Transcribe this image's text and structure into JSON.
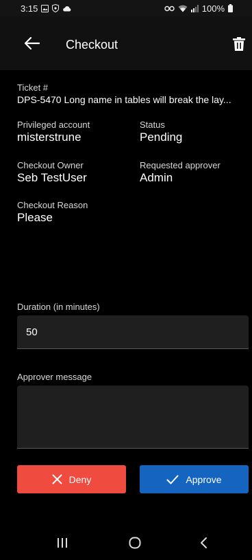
{
  "status_bar": {
    "time": "3:15",
    "battery": "100%",
    "left_icons": [
      "image-icon",
      "shield-icon",
      "cloud-icon"
    ],
    "right_icons": [
      "link-icon",
      "wifi-icon",
      "signal-icon",
      "battery-icon"
    ]
  },
  "app_bar": {
    "title": "Checkout",
    "back_icon": "arrow-left-icon",
    "delete_icon": "trash-icon"
  },
  "details": {
    "ticket_label": "Ticket #",
    "ticket_value": "DPS-5470 Long name in tables will break the lay...",
    "privileged_label": "Privileged account",
    "privileged_value": "misterstrune",
    "status_label": "Status",
    "status_value": "Pending",
    "owner_label": "Checkout Owner",
    "owner_value": "Seb TestUser",
    "approver_label": "Requested approver",
    "approver_value": "Admin",
    "reason_label": "Checkout Reason",
    "reason_value": "Please"
  },
  "duration": {
    "label": "Duration (in minutes)",
    "value": "50"
  },
  "approver_message": {
    "label": "Approver message",
    "value": ""
  },
  "actions": {
    "deny_label": "Deny",
    "approve_label": "Approve",
    "deny_color": "#ef4b3e",
    "approve_color": "#1565c0"
  },
  "nav": {
    "icons": [
      "recent-apps-icon",
      "home-icon",
      "back-icon"
    ]
  }
}
